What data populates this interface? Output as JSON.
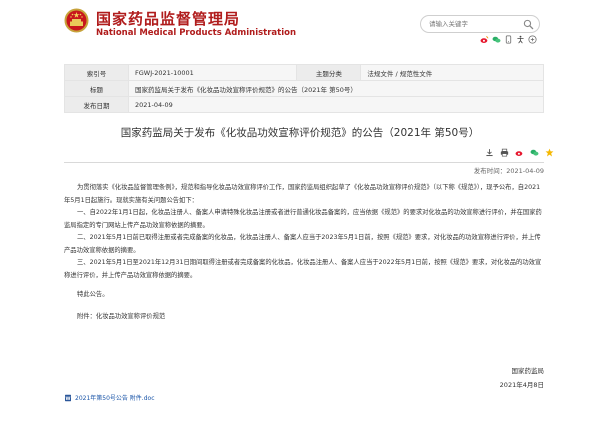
{
  "header": {
    "site_name_cn": "国家药品监督管理局",
    "site_name_en": "National Medical Products Administration",
    "search_placeholder": "请输入关键字",
    "share_icons": [
      "weibo-icon",
      "wechat-icon",
      "mobile-icon",
      "accessibility-icon",
      "elder-mode-icon"
    ]
  },
  "meta": {
    "index_label": "索引号",
    "index_value": "FGWJ-2021-10001",
    "category_label": "主题分类",
    "category_value": "法规文件 / 规范性文件",
    "heading_label": "标题",
    "heading_value": "国家药监局关于发布《化妆品功效宣称评价规范》的公告（2021年 第50号）",
    "date_label": "发布日期",
    "date_value": "2021-04-09"
  },
  "article": {
    "title": "国家药监局关于发布《化妆品功效宣称评价规范》的公告（2021年 第50号）",
    "date_line": "发布时间：2021-04-09",
    "paragraphs": [
      "为贯彻落实《化妆品监督管理条例》，规范和指导化妆品功效宣称评价工作，国家药监局组织起草了《化妆品功效宣称评价规范》（以下称《规范》），现予公布，自2021年5月1日起施行。现就实施有关问题公告如下：",
      "一、自2022年1月1日起，化妆品注册人、备案人申请特殊化妆品注册或者进行普通化妆品备案的，应当依据《规范》的要求对化妆品的功效宣称进行评价，并在国家药监局指定的专门网站上传产品功效宣称依据的摘要。",
      "二、2021年5月1日前已取得注册或者完成备案的化妆品，化妆品注册人、备案人应当于2023年5月1日前，按照《规范》要求，对化妆品的功效宣称进行评价，并上传产品功效宣称依据的摘要。",
      "三、2021年5月1日至2021年12月31日期间取得注册或者完成备案的化妆品，化妆品注册人、备案人应当于2022年5月1日前，按照《规范》要求，对化妆品的功效宣称进行评价，并上传产品功效宣称依据的摘要。",
      "特此公告。",
      "附件：化妆品功效宣称评价规范"
    ],
    "signature_org": "国家药监局",
    "signature_date": "2021年4月8日",
    "attachment_link": "2021年第50号公告 附件.doc"
  },
  "colors": {
    "brand_red": "#b01c1c",
    "link_blue": "#1a55a8"
  }
}
